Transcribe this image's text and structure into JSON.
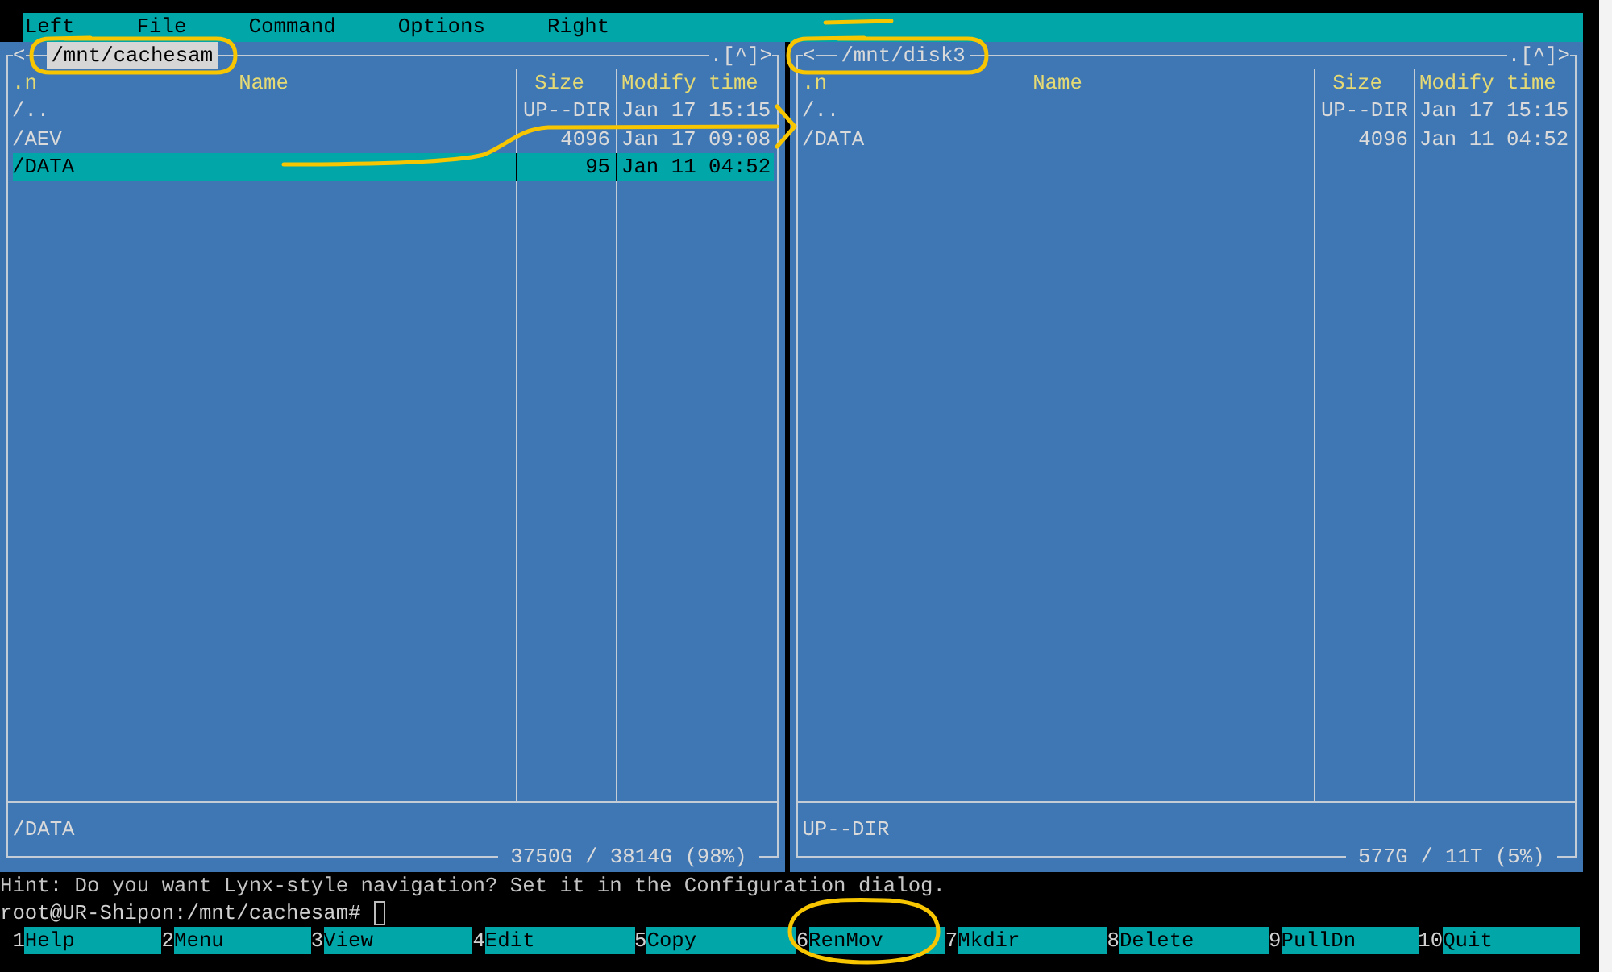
{
  "menu_bar": [
    "Left",
    "File",
    "Command",
    "Options",
    "Right"
  ],
  "panels": [
    {
      "active": true,
      "history_back": "<",
      "path": "/mnt/cachesam",
      "history_menu": ".[^]>",
      "sort_indicator": ".n",
      "columns": [
        "Name",
        "Size",
        "Modify time"
      ],
      "rows": [
        {
          "name": "/..",
          "size": "UP--DIR",
          "modified": "Jan 17 15:15",
          "selected": false
        },
        {
          "name": "/AEV",
          "size": "4096",
          "modified": "Jan 17 09:08",
          "selected": false
        },
        {
          "name": "/DATA",
          "size": "95",
          "modified": "Jan 11 04:52",
          "selected": true
        }
      ],
      "mini_status": "/DATA",
      "free_space": "3750G / 3814G (98%)"
    },
    {
      "active": false,
      "history_back": "<",
      "path": "/mnt/disk3",
      "history_menu": ".[^]>",
      "sort_indicator": ".n",
      "columns": [
        "Name",
        "Size",
        "Modify time"
      ],
      "rows": [
        {
          "name": "/..",
          "size": "UP--DIR",
          "modified": "Jan 17 15:15",
          "selected": false
        },
        {
          "name": "/DATA",
          "size": "4096",
          "modified": "Jan 11 04:52",
          "selected": false
        }
      ],
      "mini_status": "UP--DIR",
      "free_space": "577G / 11T (5%)"
    }
  ],
  "hint": "Hint: Do you want Lynx-style navigation? Set it in the Configuration dialog.",
  "prompt": "root@UR-Shipon:/mnt/cachesam#",
  "function_keys": [
    {
      "number": "1",
      "label": "Help"
    },
    {
      "number": "2",
      "label": "Menu"
    },
    {
      "number": "3",
      "label": "View"
    },
    {
      "number": "4",
      "label": "Edit"
    },
    {
      "number": "5",
      "label": "Copy"
    },
    {
      "number": "6",
      "label": "RenMov"
    },
    {
      "number": "7",
      "label": "Mkdir"
    },
    {
      "number": "8",
      "label": "Delete"
    },
    {
      "number": "9",
      "label": "PullDn"
    },
    {
      "number": "10",
      "label": "Quit"
    }
  ]
}
